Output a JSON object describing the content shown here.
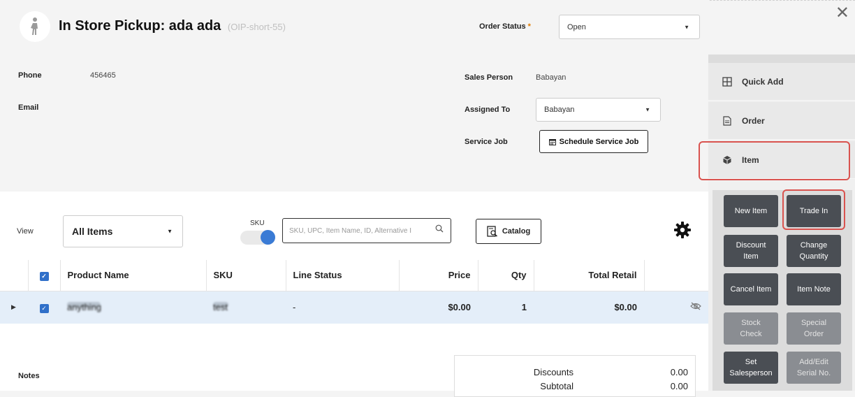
{
  "header": {
    "title": "In Store Pickup: ada ada",
    "order_code": "(OIP-short-55)",
    "status_label": "Order Status",
    "status_required": "*",
    "status_value": "Open",
    "close_glyph": "✕"
  },
  "info": {
    "phone_label": "Phone",
    "phone_value": "456465",
    "email_label": "Email",
    "sales_person_label": "Sales Person",
    "sales_person_value": "Babayan",
    "assigned_to_label": "Assigned To",
    "assigned_to_value": "Babayan",
    "service_job_label": "Service Job",
    "schedule_button": "Schedule Service Job"
  },
  "toolbar": {
    "view_label": "View",
    "view_value": "All Items",
    "sku_label": "SKU",
    "search_placeholder": "SKU, UPC, Item Name, ID, Alternative I",
    "catalog_label": "Catalog"
  },
  "table": {
    "columns": [
      "Product Name",
      "SKU",
      "Line Status",
      "Price",
      "Qty",
      "Total Retail"
    ],
    "rows": [
      {
        "product": "anything",
        "sku": "test",
        "line_status": "-",
        "price": "$0.00",
        "qty": "1",
        "total": "$0.00"
      }
    ]
  },
  "notes_label": "Notes",
  "totals": {
    "discounts_label": "Discounts",
    "discounts_value": "0.00",
    "subtotal_label": "Subtotal",
    "subtotal_value": "0.00"
  },
  "side_menu": {
    "quick_add": "Quick Add",
    "order": "Order",
    "item": "Item"
  },
  "actions": {
    "new_item": "New Item",
    "trade_in": "Trade In",
    "discount_item_1": "Discount",
    "discount_item_2": "Item",
    "change_quantity_1": "Change",
    "change_quantity_2": "Quantity",
    "cancel_item": "Cancel Item",
    "item_note": "Item Note",
    "stock_check_1": "Stock",
    "stock_check_2": "Check",
    "special_order_1": "Special",
    "special_order_2": "Order",
    "set_salesperson_1": "Set",
    "set_salesperson_2": "Salesperson",
    "add_edit_serial_1": "Add/Edit",
    "add_edit_serial_2": "Serial No."
  },
  "colors": {
    "accent_blue": "#2f6fc9",
    "highlight_red": "#d9534f",
    "action_button": "#4a4e54"
  }
}
